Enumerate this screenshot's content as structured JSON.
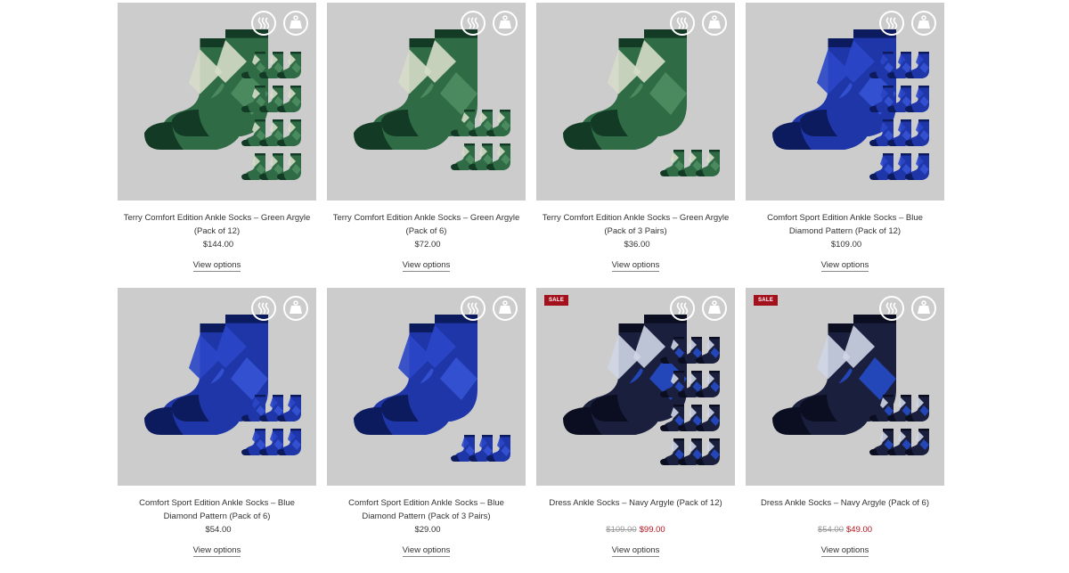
{
  "products": [
    {
      "title": "Terry Comfort Edition Ankle Socks – Green Argyle (Pack of 12)",
      "price": "$144.00",
      "old_price": "",
      "sale_badge": "",
      "view_label": "View options",
      "theme": "green",
      "packs": 12
    },
    {
      "title": "Terry Comfort Edition Ankle Socks – Green Argyle (Pack of 6)",
      "price": "$72.00",
      "old_price": "",
      "sale_badge": "",
      "view_label": "View options",
      "theme": "green",
      "packs": 6
    },
    {
      "title": "Terry Comfort Edition Ankle Socks – Green Argyle (Pack of 3 Pairs)",
      "price": "$36.00",
      "old_price": "",
      "sale_badge": "",
      "view_label": "View options",
      "theme": "green",
      "packs": 3
    },
    {
      "title": "Comfort Sport Edition Ankle Socks – Blue Diamond Pattern (Pack of 12)",
      "price": "$109.00",
      "old_price": "",
      "sale_badge": "",
      "view_label": "View options",
      "theme": "blue",
      "packs": 12
    },
    {
      "title": "Comfort Sport Edition Ankle Socks – Blue Diamond Pattern (Pack of 6)",
      "price": "$54.00",
      "old_price": "",
      "sale_badge": "",
      "view_label": "View options",
      "theme": "blue",
      "packs": 6
    },
    {
      "title": "Comfort Sport Edition Ankle Socks – Blue Diamond Pattern (Pack of 3 Pairs)",
      "price": "$29.00",
      "old_price": "",
      "sale_badge": "",
      "view_label": "View options",
      "theme": "blue",
      "packs": 3
    },
    {
      "title": "Dress Ankle Socks – Navy Argyle (Pack of 12)",
      "price": "$99.00",
      "old_price": "$109.00",
      "sale_badge": "SALE",
      "view_label": "View options",
      "theme": "navy",
      "packs": 12
    },
    {
      "title": "Dress Ankle Socks – Navy Argyle (Pack of 6)",
      "price": "$49.00",
      "old_price": "$54.00",
      "sale_badge": "SALE",
      "view_label": "View options",
      "theme": "navy",
      "packs": 6
    }
  ],
  "icons": {
    "fabric": "heat-wave-icon",
    "weight": "weight-icon"
  },
  "colors": {
    "sale_badge": "#a3111d",
    "sale_price": "#b3141c",
    "image_bg": "#cccccc"
  }
}
